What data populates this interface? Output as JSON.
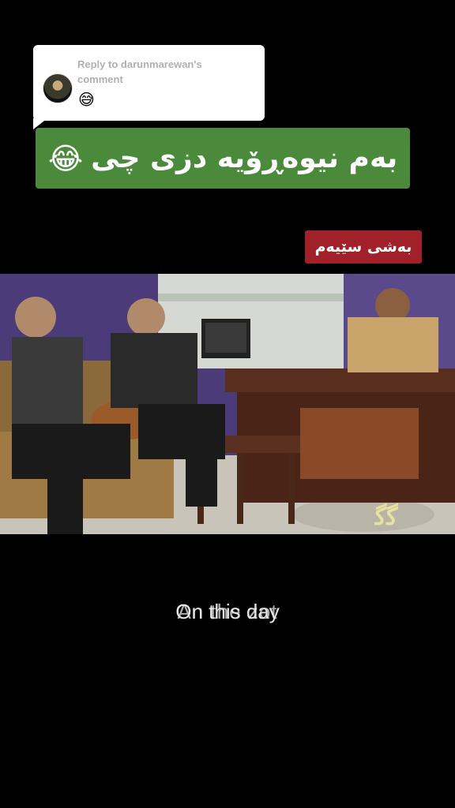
{
  "reply": {
    "title": "Reply to darunmarewan's comment",
    "emoji": "😅",
    "avatar_icon": "avatar-photo"
  },
  "banner": {
    "text": "بەم نیوەڕۆیە دزی چی",
    "emoji": "😂",
    "color": "#4a8a3a"
  },
  "tag": {
    "text": "بەشی سێیەم",
    "color": "#a1202a"
  },
  "caption": {
    "line_a": "On this day",
    "line_b": "An the zot"
  }
}
